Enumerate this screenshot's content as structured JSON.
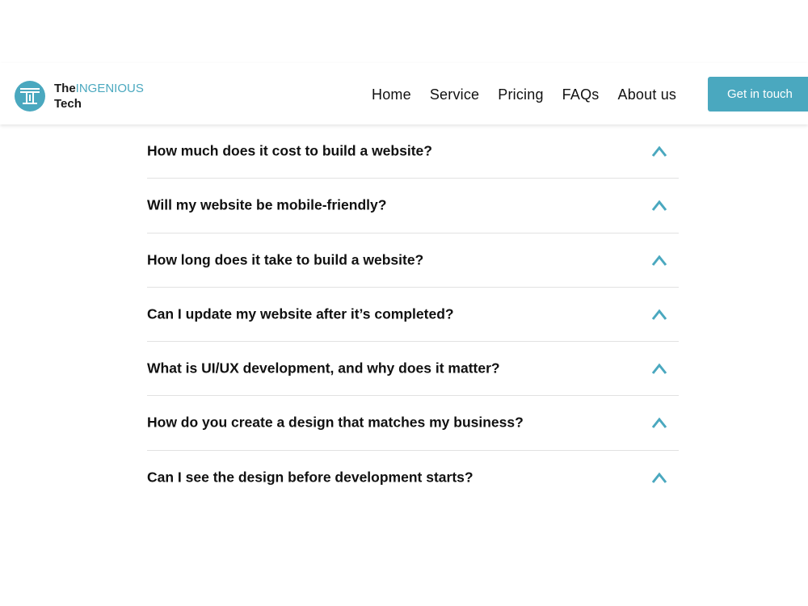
{
  "brand": {
    "name_prefix": "The",
    "name_highlight": "INGENIOUS",
    "name_suffix": "Tech",
    "logo_icon": "ti-monogram-logo",
    "accent_color": "#4aa8bf"
  },
  "nav": {
    "items": [
      {
        "label": "Home"
      },
      {
        "label": "Service"
      },
      {
        "label": "Pricing"
      },
      {
        "label": "FAQs"
      },
      {
        "label": "About us"
      }
    ],
    "cta_label": "Get in touch"
  },
  "faq": {
    "expand_icon": "chevron-up-icon",
    "items": [
      {
        "question": "How much does it cost to build a website?"
      },
      {
        "question": "Will my website be mobile-friendly?"
      },
      {
        "question": "How long does it take to build a website?"
      },
      {
        "question": "Can I update my website after it’s completed?"
      },
      {
        "question": "What is UI/UX development, and why does it matter?"
      },
      {
        "question": "How do you create a design that matches my business?"
      },
      {
        "question": "Can I see the design before development starts?"
      }
    ]
  }
}
